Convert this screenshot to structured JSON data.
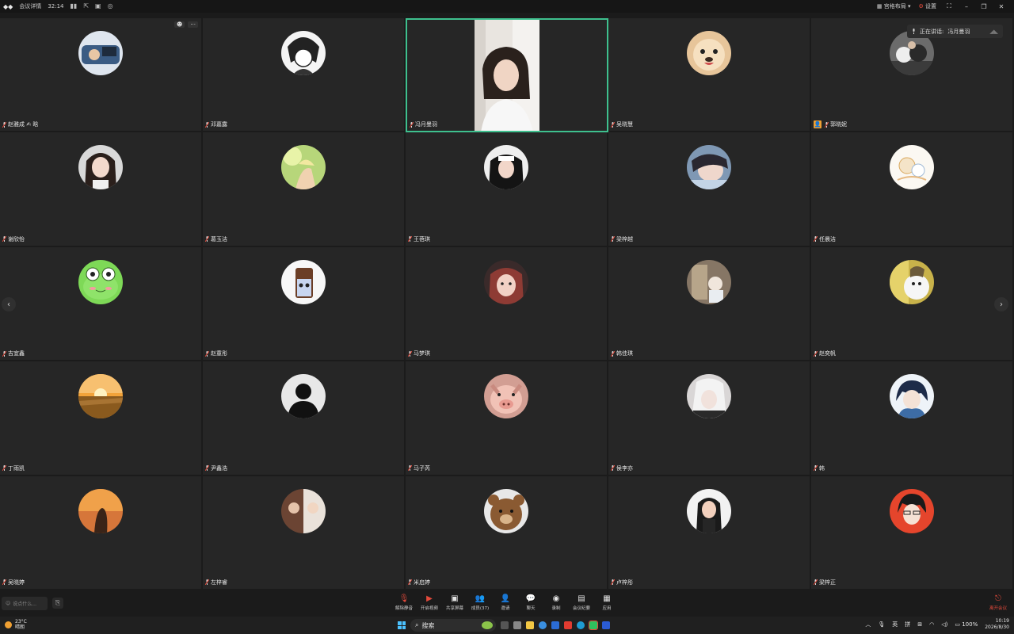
{
  "titlebar": {
    "app_name": "会议详情",
    "elapsed": "32:14",
    "layout_label": "宫格布局",
    "settings_label": "设置"
  },
  "active_speaker": {
    "label": "正在讲话:",
    "name": "冯月曼羽"
  },
  "participants": [
    {
      "name": "赵雅成 ✍ 晗",
      "avatar": "a1"
    },
    {
      "name": "邓嘉露",
      "avatar": "a2"
    },
    {
      "name": "冯月曼羽",
      "avatar": "video"
    },
    {
      "name": "吴晓慧",
      "avatar": "a4"
    },
    {
      "name": "郭晓妮",
      "avatar": "a5",
      "host": true
    },
    {
      "name": "谢欣怡",
      "avatar": "a6"
    },
    {
      "name": "葛玉洁",
      "avatar": "a7"
    },
    {
      "name": "王蓓琪",
      "avatar": "a8"
    },
    {
      "name": "梁梓越",
      "avatar": "a9"
    },
    {
      "name": "任晨洁",
      "avatar": "a10"
    },
    {
      "name": "吉宜鑫",
      "avatar": "a11"
    },
    {
      "name": "赵童彤",
      "avatar": "a12"
    },
    {
      "name": "马梦琪",
      "avatar": "a13"
    },
    {
      "name": "韩佳琪",
      "avatar": "a14"
    },
    {
      "name": "赵奕帆",
      "avatar": "a15"
    },
    {
      "name": "丁雨凯",
      "avatar": "a16"
    },
    {
      "name": "尹鑫浩",
      "avatar": "a17"
    },
    {
      "name": "马子芮",
      "avatar": "a18"
    },
    {
      "name": "侯李亦",
      "avatar": "a19"
    },
    {
      "name": "韩",
      "avatar": "a20"
    },
    {
      "name": "吴晓婷",
      "avatar": "a21"
    },
    {
      "name": "左梓睿",
      "avatar": "a22"
    },
    {
      "name": "米启婷",
      "avatar": "a23"
    },
    {
      "name": "卢梓彤",
      "avatar": "a24"
    },
    {
      "name": "梁梓正",
      "avatar": "a25"
    }
  ],
  "chat": {
    "placeholder": "说点什么..."
  },
  "toolbar": {
    "items": [
      {
        "label": "解除静音",
        "icon": "mic-off-icon"
      },
      {
        "label": "开启视频",
        "icon": "camera-off-icon"
      },
      {
        "label": "共享屏幕",
        "icon": "share-screen-icon"
      },
      {
        "label": "成员(37)",
        "icon": "members-icon"
      },
      {
        "label": "邀请",
        "icon": "invite-icon"
      },
      {
        "label": "聊天",
        "icon": "chat-icon"
      },
      {
        "label": "录制",
        "icon": "record-icon"
      },
      {
        "label": "会议纪要",
        "icon": "notes-icon"
      },
      {
        "label": "应用",
        "icon": "apps-icon"
      }
    ],
    "end_label": "离开会议"
  },
  "taskbar": {
    "temperature": "23°C",
    "weather": "晴朗",
    "search": "搜索",
    "lang1": "英",
    "lang2": "拼",
    "battery": "100%",
    "time": "10:19",
    "date": "2026/8/30"
  },
  "colors": {
    "speaking_border": "#3ec08e",
    "end_red": "#e34a3b",
    "host_badge": "#f0a033"
  }
}
